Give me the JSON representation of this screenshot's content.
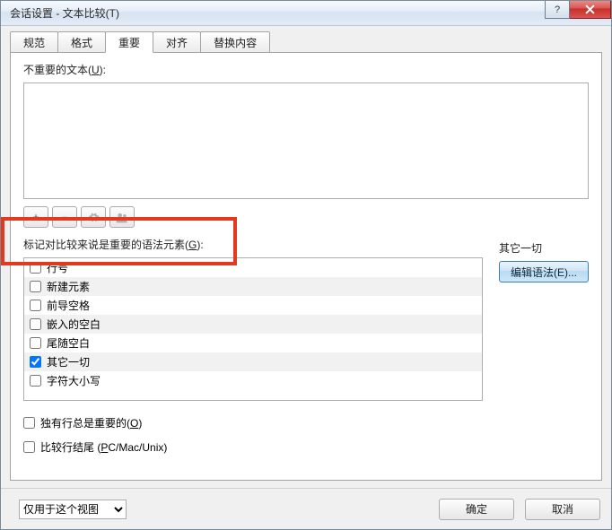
{
  "window": {
    "title": "会话设置 - 文本比较(T)"
  },
  "tabs": {
    "t0": "规范",
    "t1": "格式",
    "t2": "重要",
    "t3": "对齐",
    "t4": "替换内容"
  },
  "unimportant": {
    "label_pre": "不重要的文本(",
    "label_u": "U",
    "label_post": "):",
    "value": ""
  },
  "toolbar": {
    "add": "+",
    "remove": "−"
  },
  "syntax": {
    "label_pre": "标记对比较来说是重要的语法元素(",
    "label_u": "G",
    "label_post": "):",
    "items": [
      {
        "label": "行号",
        "checked": false
      },
      {
        "label": "新建元素",
        "checked": false
      },
      {
        "label": "前导空格",
        "checked": false
      },
      {
        "label": "嵌入的空白",
        "checked": false
      },
      {
        "label": "尾随空白",
        "checked": false
      },
      {
        "label": "其它一切",
        "checked": true
      },
      {
        "label": "字符大小写",
        "checked": false
      }
    ]
  },
  "everything_else": {
    "head": "其它一切",
    "button": "编辑语法(E)..."
  },
  "orphan": {
    "pre": "独有行总是重要的(",
    "u": "O",
    "post": ")"
  },
  "line_endings": {
    "pre": "比较行结尾 (",
    "u": "P",
    "post": "C/Mac/Unix)"
  },
  "footer": {
    "scope": "仅用于这个视图",
    "ok": "确定",
    "cancel": "取消"
  }
}
